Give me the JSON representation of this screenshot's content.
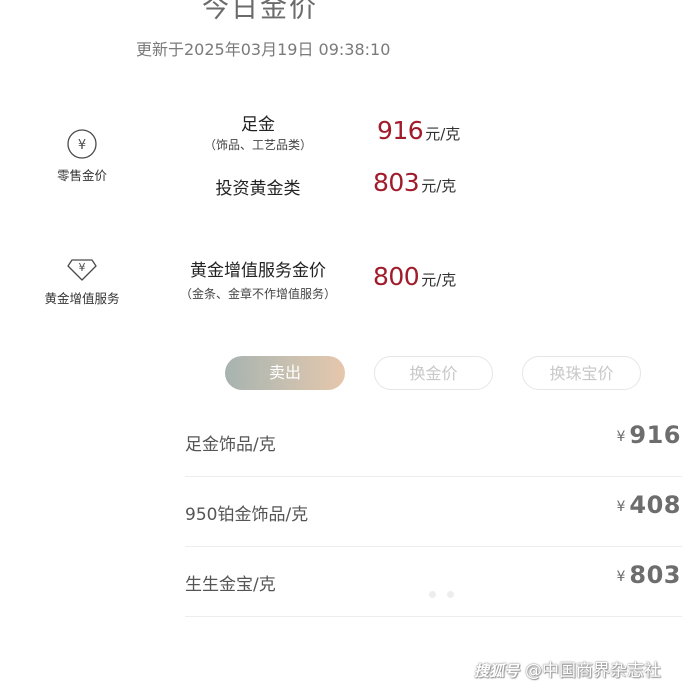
{
  "header": {
    "title": "今日金价",
    "timestamp": "更新于2025年03月19日 09:38:10"
  },
  "categories": [
    {
      "label": "零售金价",
      "icon": "yen-circle-icon"
    },
    {
      "label": "黄金增值服务",
      "icon": "yen-diamond-icon"
    }
  ],
  "products": [
    {
      "name": "足金",
      "sub": "（饰品、工艺品类）",
      "price": "916",
      "unit": "元/克"
    },
    {
      "name": "投资黄金类",
      "price": "803",
      "unit": "元/克"
    },
    {
      "name": "黄金增值服务金价",
      "sub": "（金条、金章不作增值服务）",
      "price": "800",
      "unit": "元/克"
    }
  ],
  "tabs": [
    {
      "label": "卖出",
      "active": true
    },
    {
      "label": "换金价",
      "active": false
    },
    {
      "label": "换珠宝价",
      "active": false
    }
  ],
  "list": [
    {
      "label": "足金饰品/克",
      "currency": "¥",
      "price": "916"
    },
    {
      "label": "950铂金饰品/克",
      "currency": "¥",
      "price": "408"
    },
    {
      "label": "生生金宝/克",
      "currency": "¥",
      "price": "803"
    }
  ],
  "watermark": {
    "logo": "搜狐号",
    "text": "@中国商界杂志社"
  },
  "colors": {
    "price_red": "#a01c2b",
    "tab_gradient_start": "#a7b3b0",
    "tab_gradient_end": "#e6c7ac",
    "list_price_gray": "#6d6d6d"
  }
}
